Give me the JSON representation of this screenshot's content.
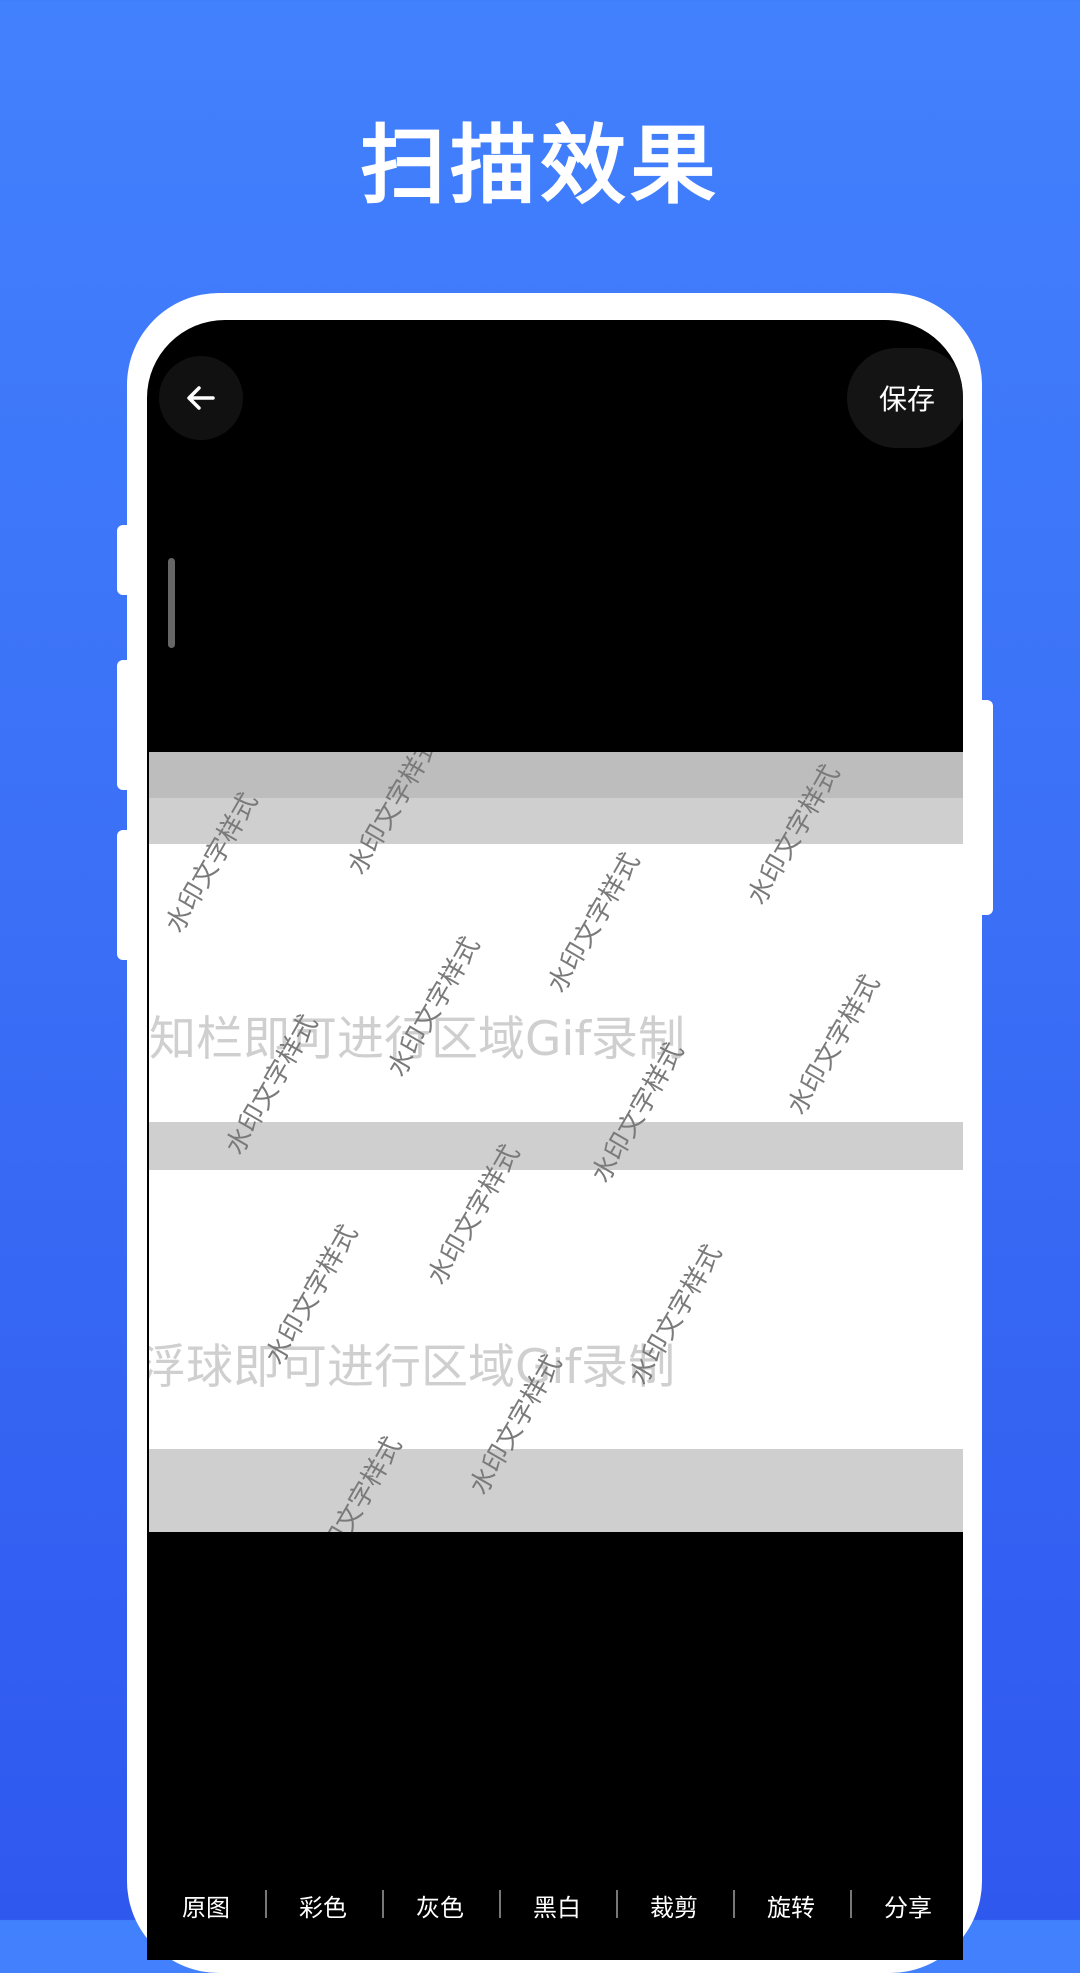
{
  "promo": {
    "title": "扫描效果"
  },
  "header": {
    "save_label": "保存"
  },
  "document": {
    "lines": [
      "知栏即可进行区域Gif录制",
      "浮球即可进行区域Gif录制"
    ],
    "watermark_text": "水印文字样式"
  },
  "toolbar": {
    "items": [
      "原图",
      "彩色",
      "灰色",
      "黑白",
      "裁剪",
      "旋转",
      "分享"
    ]
  },
  "colors": {
    "accent": "#3a6ef6",
    "panel": "#000000"
  }
}
